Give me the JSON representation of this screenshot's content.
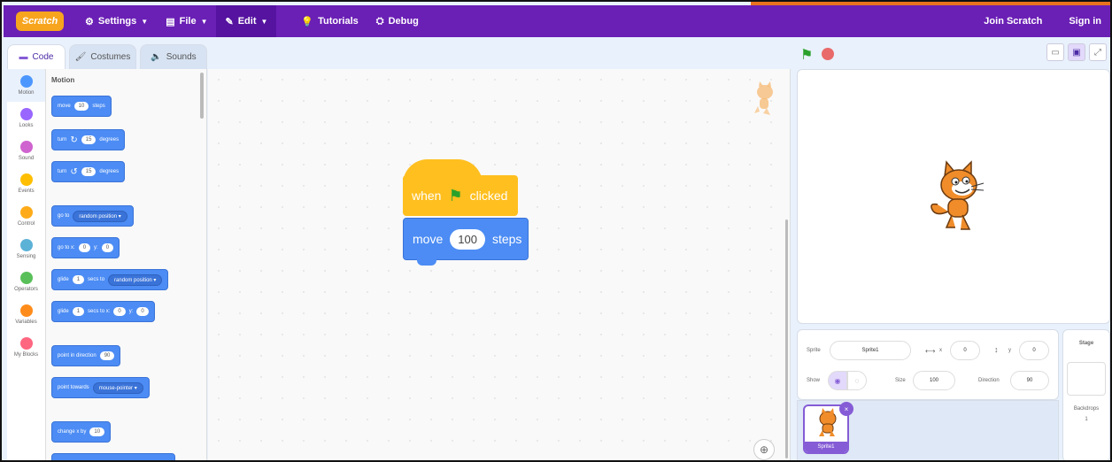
{
  "menubar": {
    "logo": "Scratch",
    "settings": "Settings",
    "file": "File",
    "edit": "Edit",
    "tutorials": "Tutorials",
    "debug": "Debug",
    "join": "Join Scratch",
    "signin": "Sign in"
  },
  "tabs": {
    "code": "Code",
    "costumes": "Costumes",
    "sounds": "Sounds"
  },
  "categories": [
    {
      "label": "Motion",
      "color": "#4c97ff"
    },
    {
      "label": "Looks",
      "color": "#9966ff"
    },
    {
      "label": "Sound",
      "color": "#cf63cf"
    },
    {
      "label": "Events",
      "color": "#ffbf00"
    },
    {
      "label": "Control",
      "color": "#ffab19"
    },
    {
      "label": "Sensing",
      "color": "#5cb1d6"
    },
    {
      "label": "Operators",
      "color": "#59c059"
    },
    {
      "label": "Variables",
      "color": "#ff8c1a"
    },
    {
      "label": "My Blocks",
      "color": "#ff6680"
    }
  ],
  "palette": {
    "title": "Motion",
    "move": {
      "a": "move",
      "val": "10",
      "b": "steps"
    },
    "turn_cw": {
      "a": "turn",
      "val": "15",
      "b": "degrees"
    },
    "turn_ccw": {
      "a": "turn",
      "val": "15",
      "b": "degrees"
    },
    "goto": {
      "a": "go to",
      "val": "random position"
    },
    "gotoxy": {
      "a": "go to x:",
      "x": "0",
      "y_label": "y:",
      "y": "0"
    },
    "glide": {
      "a": "glide",
      "val": "1",
      "b": "secs to",
      "target": "random position"
    },
    "glidexy": {
      "a": "glide",
      "val": "1",
      "b": "secs to x:",
      "x": "0",
      "y_label": "y:",
      "y": "0"
    },
    "point": {
      "a": "point in direction",
      "val": "90"
    },
    "towards": {
      "a": "point towards",
      "val": "mouse-pointer"
    },
    "changex": {
      "a": "change x by",
      "val": "10"
    }
  },
  "script": {
    "hat": {
      "a": "when",
      "b": "clicked"
    },
    "move": {
      "a": "move",
      "val": "100",
      "b": "steps"
    }
  },
  "sprite_info": {
    "sprite_label": "Sprite",
    "sprite_name": "Sprite1",
    "x_label": "x",
    "x": "0",
    "y_label": "y",
    "y": "0",
    "show_label": "Show",
    "size_label": "Size",
    "size": "100",
    "direction_label": "Direction",
    "direction": "90"
  },
  "sprite_list": {
    "card_name": "Sprite1",
    "delete": "×"
  },
  "stage_panel": {
    "title": "Stage",
    "backdrops_label": "Backdrops",
    "backdrops_count": "1"
  }
}
